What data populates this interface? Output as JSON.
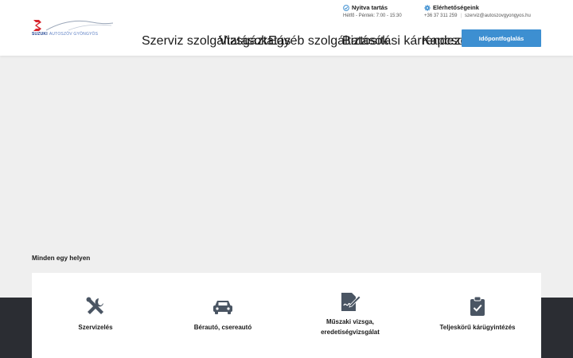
{
  "logo": {
    "brand": "SUZUKI",
    "sub": "AUTOSZÖV GYÖNGYÖS"
  },
  "info_open": {
    "title": "Nyitva tartás",
    "hours": "Hétfő - Péntek: 7:00 - 15:30"
  },
  "info_contact": {
    "title": "Elérhetőségeink",
    "phone": "+36 37 311 259",
    "separator": "|",
    "email": "szerviz@autoszovgyongyos.hu"
  },
  "nav": {
    "items": [
      {
        "label": "Szerviz szolgáltatások"
      },
      {
        "label": "Vizsgáztatás"
      },
      {
        "label": "Egyéb szolgáltatások"
      },
      {
        "label": "Biztosítási kárrendezés"
      },
      {
        "label": "Kapcsolat"
      }
    ],
    "cta": "Időpontfoglalás"
  },
  "section": {
    "title": "Minden egy helyen"
  },
  "cards": [
    {
      "icon": "tools-icon",
      "label": "Szervizelés"
    },
    {
      "icon": "car-icon",
      "label": "Bérautó, csereautó"
    },
    {
      "icon": "document-signature-icon",
      "label_line1": "Műszaki vizsga,",
      "label_line2": "eredetiségvizsgálat"
    },
    {
      "icon": "clipboard-check-icon",
      "label": "Teljeskörű kárügyintézés"
    }
  ],
  "colors": {
    "accent": "#3d8fd1",
    "dark_band": "#2b2d33",
    "page_bg": "#efefef",
    "icon": "#4a5563"
  }
}
